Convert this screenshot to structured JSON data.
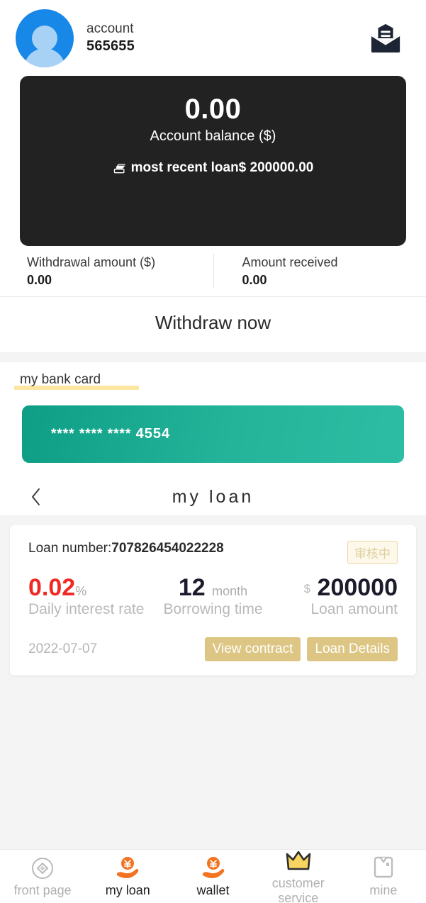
{
  "header": {
    "avatar_icon": "user-avatar-icon",
    "account_label": "account",
    "account_number": "565655",
    "mail_icon": "mail-open-icon"
  },
  "balance": {
    "amount": "0.00",
    "label": "Account balance ($)",
    "recent_icon": "money-stack-icon",
    "recent_loan_text": "most recent loan$ 200000.00"
  },
  "withdraw": {
    "amount_label": "Withdrawal amount ($)",
    "amount_value": "0.00",
    "received_label": "Amount received",
    "received_value": "0.00",
    "action_label": "Withdraw now"
  },
  "bank": {
    "section_label": "my bank card",
    "card_masked": "**** **** ****",
    "card_last4": "4554"
  },
  "loan_header": {
    "back_icon": "chevron-left-icon",
    "title": "my loan"
  },
  "loan": {
    "number_label": "Loan number:",
    "number_value": "707826454022228",
    "status": "审核中",
    "rate_value": "0.02",
    "rate_unit": "%",
    "rate_caption": "Daily interest rate",
    "term_value": "12",
    "term_unit": "month",
    "term_caption": "Borrowing time",
    "amount_prefix": "$",
    "amount_value": "200000",
    "amount_caption": "Loan amount",
    "date": "2022-07-07",
    "view_contract_label": "View contract",
    "loan_details_label": "Loan Details"
  },
  "tabbar": {
    "items": [
      {
        "label": "front page",
        "icon": "home-diamond-icon",
        "active": false
      },
      {
        "label": "my loan",
        "icon": "hand-yuan-coin-icon",
        "active": true
      },
      {
        "label": "wallet",
        "icon": "hand-yuan-coin-icon",
        "active": true
      },
      {
        "label": "customer service",
        "icon": "crown-icon",
        "active": false
      },
      {
        "label": "mine",
        "icon": "bookmark-icon",
        "active": false
      }
    ]
  },
  "colors": {
    "accent_orange": "#f37321",
    "card_teal": "#1aab92",
    "badge_gold": "#ddc683",
    "rate_red": "#ef2a24",
    "balance_dark": "#222222"
  }
}
